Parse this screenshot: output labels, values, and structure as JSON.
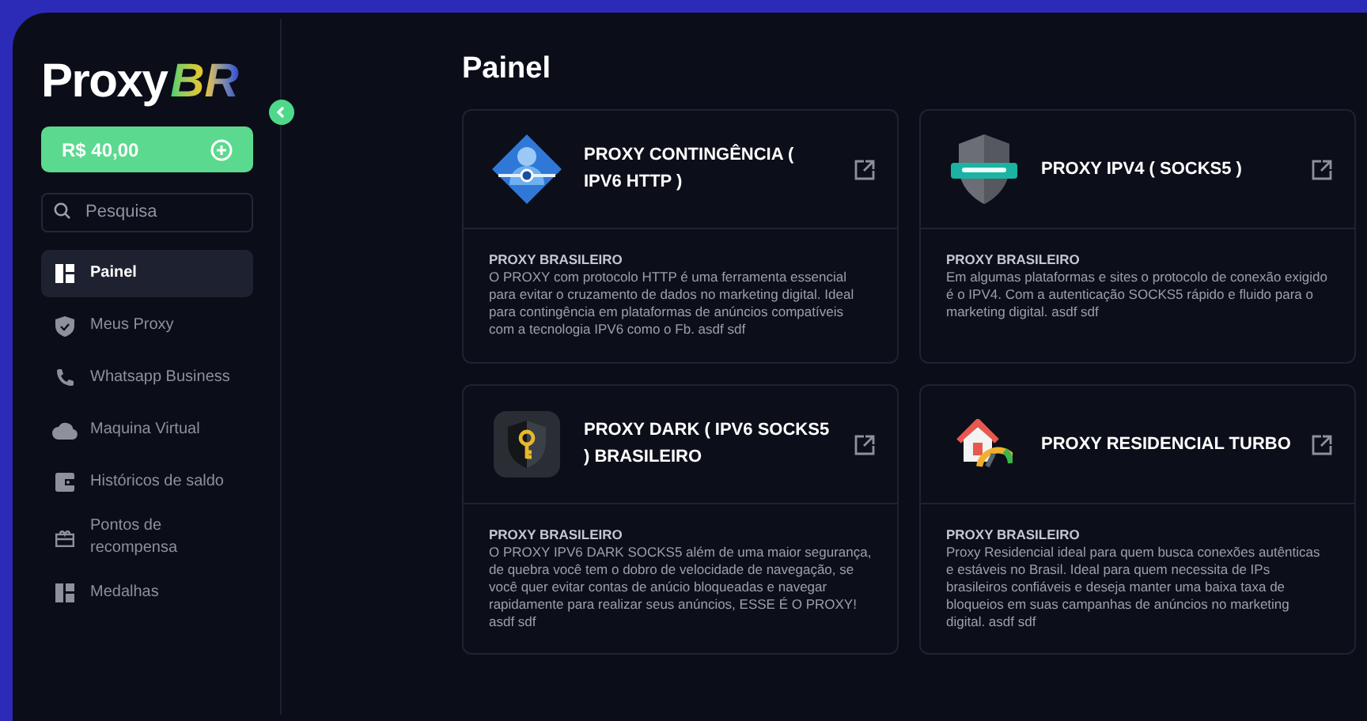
{
  "logo": {
    "name": "Proxy",
    "mark": "BR"
  },
  "balance": {
    "amount": "R$ 40,00"
  },
  "search": {
    "placeholder": "Pesquisa"
  },
  "sidebar": {
    "items": [
      {
        "label": "Painel",
        "kind": "panel",
        "selected": true
      },
      {
        "label": "Meus Proxy",
        "kind": "shield",
        "selected": false
      },
      {
        "label": "Whatsapp Business",
        "kind": "phone",
        "selected": false
      },
      {
        "label": "Maquina Virtual",
        "kind": "cloud",
        "selected": false
      },
      {
        "label": "Históricos de saldo",
        "kind": "wallet",
        "selected": false
      },
      {
        "label": "Pontos de recompensa",
        "kind": "gift",
        "selected": false
      },
      {
        "label": "Medalhas",
        "kind": "panel",
        "selected": false
      }
    ]
  },
  "page": {
    "title": "Painel"
  },
  "cards": [
    {
      "kind": "person",
      "title": "PROXY CONTINGÊNCIA ( IPV6 HTTP )",
      "subtitle": "PROXY BRASILEIRO",
      "description": "O PROXY com protocolo HTTP é uma ferramenta essencial para evitar o cruzamento de dados no marketing digital. Ideal para contingência em plataformas de anúncios compatíveis com a tecnologia IPV6 como o Fb. asdf sdf"
    },
    {
      "kind": "socks",
      "title": "PROXY IPV4 ( SOCKS5 )",
      "subtitle": "PROXY BRASILEIRO",
      "description": "Em algumas plataformas e sites o protocolo de conexão exigido é o IPV4. Com a autenticação SOCKS5 rápido e fluido para o marketing digital. asdf sdf"
    },
    {
      "kind": "key",
      "title": "PROXY DARK ( IPV6 SOCKS5 ) BRASILEIRO",
      "subtitle": "PROXY BRASILEIRO",
      "description": "O PROXY IPV6 DARK SOCKS5 além de uma maior segurança, de quebra você tem o dobro de velocidade de navegação, se você quer evitar contas de anúcio bloqueadas e navegar rapidamente para realizar seus anúncios, ESSE É O PROXY! asdf sdf"
    },
    {
      "kind": "house",
      "title": "PROXY RESIDENCIAL TURBO",
      "subtitle": "PROXY BRASILEIRO",
      "description": "Proxy Residencial ideal para quem busca conexões autênticas e estáveis no Brasil. Ideal para quem necessita de IPs brasileiros confiáveis e deseja manter uma baixa taxa de bloqueios em suas campanhas de anúncios no marketing digital. asdf sdf"
    }
  ]
}
